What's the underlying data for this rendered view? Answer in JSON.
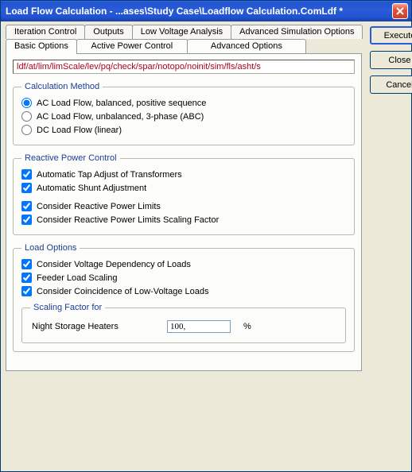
{
  "window": {
    "title": "Load Flow Calculation - ...ases\\Study Case\\Loadflow Calculation.ComLdf *"
  },
  "buttons": {
    "execute": "Execute",
    "close": "Close",
    "cancel": "Cancel"
  },
  "tabs": {
    "row1": {
      "iteration": "Iteration Control",
      "outputs": "Outputs",
      "lowvoltage": "Low Voltage Analysis",
      "advsim": "Advanced Simulation Options"
    },
    "row2": {
      "basic": "Basic Options",
      "activepower": "Active Power Control",
      "advopt": "Advanced Options"
    }
  },
  "path": "ldf/at/lim/limScale/lev/pq/check/spar/notopo/noinit/sim/fls/asht/s",
  "calcmethod": {
    "legend": "Calculation Method",
    "opt1": "AC Load Flow, balanced, positive sequence",
    "opt2": "AC Load Flow, unbalanced, 3-phase (ABC)",
    "opt3": "DC Load Flow (linear)"
  },
  "reactive": {
    "legend": "Reactive Power Control",
    "chk1": "Automatic Tap Adjust of Transformers",
    "chk2": "Automatic Shunt Adjustment",
    "chk3": "Consider Reactive Power Limits",
    "chk4": "Consider Reactive Power Limits Scaling Factor"
  },
  "loadopts": {
    "legend": "Load Options",
    "chk1": "Consider Voltage Dependency of Loads",
    "chk2": "Feeder Load Scaling",
    "chk3": "Consider Coincidence of Low-Voltage Loads",
    "sf_legend": "Scaling Factor for",
    "sf_label": "Night Storage Heaters",
    "sf_value": "100,",
    "sf_unit": "%"
  }
}
